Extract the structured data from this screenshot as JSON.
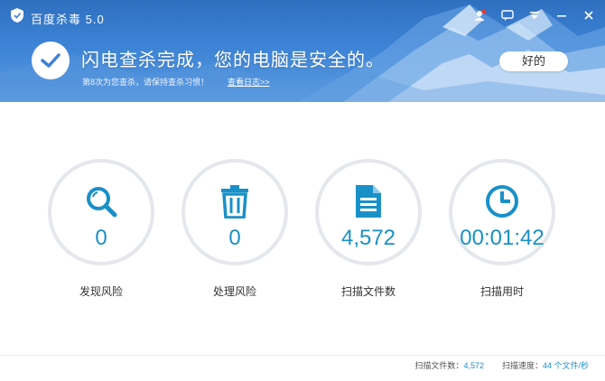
{
  "titlebar": {
    "title": "百度杀毒 5.0",
    "icons": [
      "person-badge-icon",
      "chat-icon",
      "dropdown-menu-icon",
      "minimize-icon",
      "close-icon"
    ]
  },
  "status": {
    "title": "闪电查杀完成，您的电脑是安全的。",
    "subtitle": "第8次为您查杀，请保持查杀习惯！",
    "log_link": "查看日志>>",
    "ok_button": "好的"
  },
  "stats": [
    {
      "value": "0",
      "label": "发现风险",
      "icon": "search-icon"
    },
    {
      "value": "0",
      "label": "处理风险",
      "icon": "trash-icon"
    },
    {
      "value": "4,572",
      "label": "扫描文件数",
      "icon": "document-icon"
    },
    {
      "value": "00:01:42",
      "label": "扫描用时",
      "icon": "clock-icon"
    }
  ],
  "footer": {
    "files_label": "扫描文件数：",
    "files_value": "4,572",
    "speed_label": "扫描速度：",
    "speed_value": "44 个文件/秒"
  },
  "colors": {
    "header_blue": "#3d83d6",
    "accent": "#1a90c8",
    "ring_gray": "#e4e7eb"
  }
}
